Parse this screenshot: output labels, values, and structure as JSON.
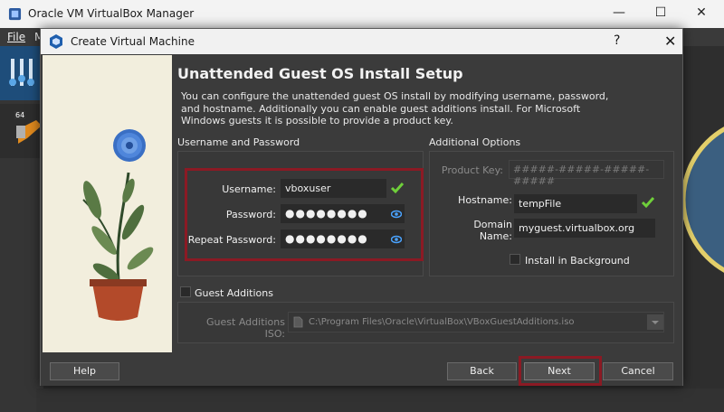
{
  "manager": {
    "title": "Oracle VM VirtualBox Manager",
    "menu_file": "File",
    "menu_machine": "M",
    "vm_badge": "64"
  },
  "dialog": {
    "title": "Create Virtual Machine",
    "help_glyph": "?",
    "close_glyph": "✕",
    "heading": "Unattended Guest OS Install Setup",
    "description": "You can configure the unattended guest OS install by modifying username, password, and hostname. Additionally you can enable guest additions install. For Microsoft Windows guests it is possible to provide a product key.",
    "user_group": {
      "title": "Username and Password",
      "username_label": "Username:",
      "username_value": "vboxuser",
      "password_label": "Password:",
      "password_value": "●●●●●●●●",
      "repeat_label": "Repeat Password:",
      "repeat_value": "●●●●●●●●"
    },
    "options_group": {
      "title": "Additional Options",
      "product_key_label": "Product Key:",
      "product_key_placeholder": "#####-#####-#####-#####",
      "hostname_label": "Hostname:",
      "hostname_value": "tempFile",
      "domain_label": "Domain Name:",
      "domain_value": "myguest.virtualbox.org",
      "install_bg_label": "Install in Background"
    },
    "guest_additions": {
      "label": "Guest Additions",
      "iso_label": "Guest Additions ISO:",
      "iso_value": "C:\\Program Files\\Oracle\\VirtualBox\\VBoxGuestAdditions.iso"
    },
    "buttons": {
      "help": "Help",
      "back": "Back",
      "next": "Next",
      "cancel": "Cancel"
    }
  },
  "colors": {
    "highlight": "#8b1a24",
    "valid_check": "#6fcf3a",
    "dialog_bg": "#3b3b3b"
  }
}
